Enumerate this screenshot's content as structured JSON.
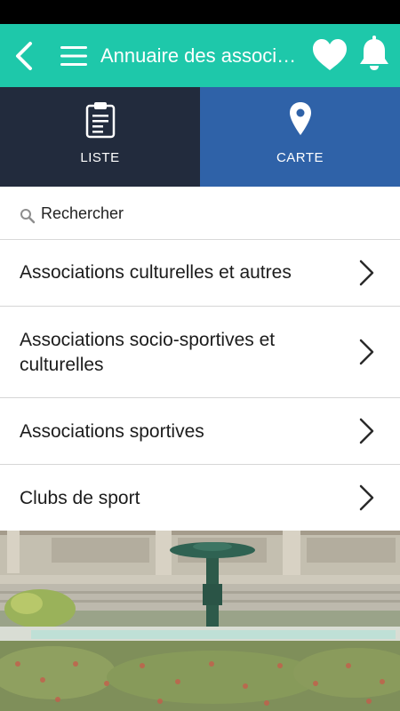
{
  "header": {
    "title": "Annuaire des associations",
    "back_icon": "chevron-left-icon",
    "menu_icon": "hamburger-menu-icon",
    "favorite_icon": "heart-icon",
    "notification_icon": "bell-icon",
    "background_color": "#1ec8aa"
  },
  "tabs": [
    {
      "label": "LISTE",
      "icon": "clipboard-list-icon",
      "color": "#222b3d"
    },
    {
      "label": "CARTE",
      "icon": "map-pin-icon",
      "color": "#2f62a8"
    }
  ],
  "search": {
    "placeholder": "Rechercher",
    "icon": "search-icon"
  },
  "categories": [
    {
      "label": "Associations culturelles et autres"
    },
    {
      "label": "Associations socio-sportives et culturelles"
    },
    {
      "label": "Associations sportives"
    },
    {
      "label": "Clubs de sport"
    }
  ]
}
